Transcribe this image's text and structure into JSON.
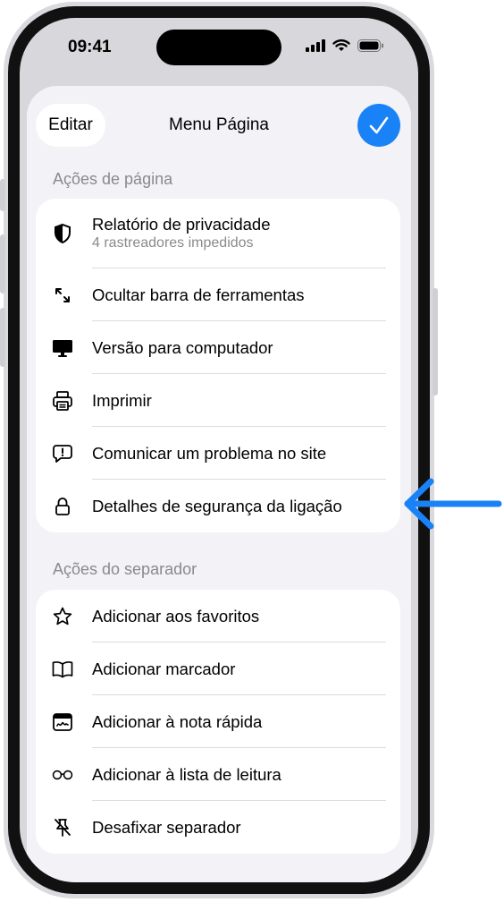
{
  "status_bar": {
    "time": "09:41"
  },
  "sheet": {
    "title": "Menu Página",
    "edit_label": "Editar",
    "done_icon": "checkmark-icon"
  },
  "page_actions": {
    "header": "Ações de página",
    "items": [
      {
        "label": "Relatório de privacidade",
        "sublabel": "4 rastreadores impedidos",
        "icon": "privacy-shield-icon"
      },
      {
        "label": "Ocultar barra de ferramentas",
        "icon": "resize-arrows-icon"
      },
      {
        "label": "Versão para computador",
        "icon": "desktop-icon"
      },
      {
        "label": "Imprimir",
        "icon": "printer-icon"
      },
      {
        "label": "Comunicar um problema no site",
        "icon": "report-bubble-icon"
      },
      {
        "label": "Detalhes de segurança da ligação",
        "icon": "lock-icon"
      }
    ]
  },
  "tab_actions": {
    "header": "Ações do separador",
    "items": [
      {
        "label": "Adicionar aos favoritos",
        "icon": "star-icon"
      },
      {
        "label": "Adicionar marcador",
        "icon": "book-icon"
      },
      {
        "label": "Adicionar à nota rápida",
        "icon": "quick-note-icon"
      },
      {
        "label": "Adicionar à lista de leitura",
        "icon": "glasses-icon"
      },
      {
        "label": "Desafixar separador",
        "icon": "unpin-icon"
      }
    ]
  },
  "colors": {
    "accent": "#1a82f7",
    "arrow": "#1a82f7",
    "secondary_text": "#8a8a8e"
  }
}
